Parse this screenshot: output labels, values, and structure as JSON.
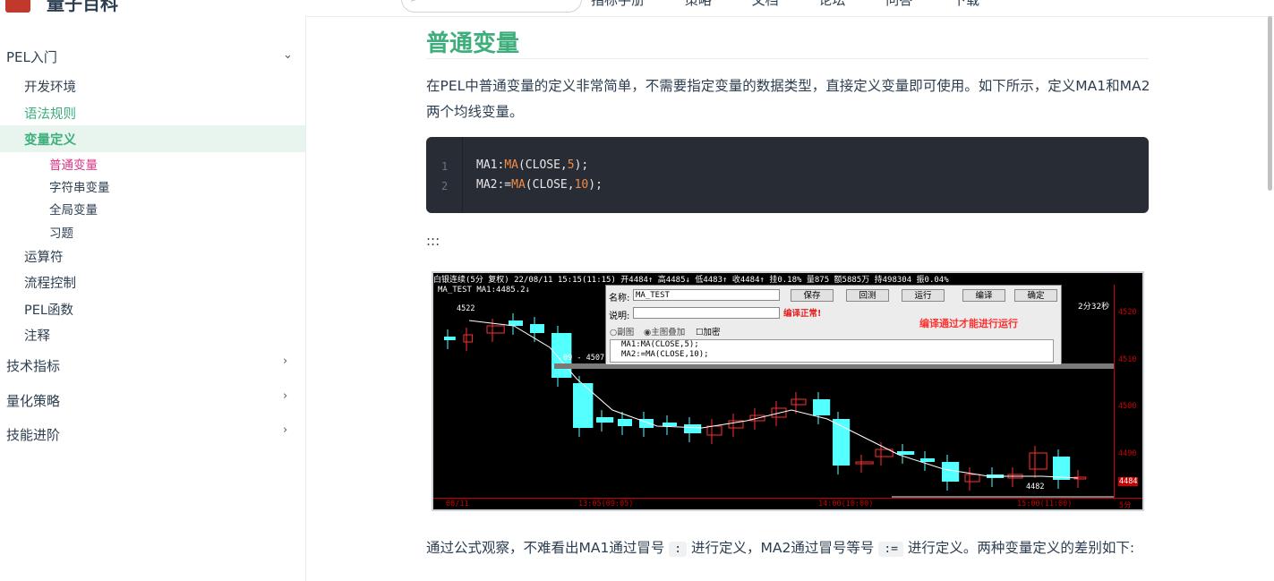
{
  "header": {
    "site_title": "量子百科",
    "nav": [
      "指标手册",
      "策略",
      "文档",
      "论坛",
      "问答",
      "下载"
    ]
  },
  "sidebar": {
    "groups": [
      {
        "title": "PEL入门",
        "expanded": true
      },
      {
        "title": "技术指标",
        "expanded": false
      },
      {
        "title": "量化策略",
        "expanded": false
      },
      {
        "title": "技能进阶",
        "expanded": false
      }
    ],
    "items": [
      "开发环境",
      "语法规则",
      "变量定义",
      "运算符",
      "流程控制",
      "PEL函数",
      "注释"
    ],
    "subitems": [
      "普通变量",
      "字符串变量",
      "全局变量",
      "习题"
    ]
  },
  "article": {
    "title": "普通变量",
    "intro": "在PEL中普通变量的定义非常简单，不需要指定变量的数据类型，直接定义变量即可使用。如下所示，定义MA1和MA2两个均线变量。",
    "code": {
      "line_numbers": [
        "1",
        "2"
      ],
      "line1": {
        "a": "MA1:",
        "fn": "MA",
        "b": "(CLOSE,",
        "num": "5",
        "c": ");"
      },
      "line2": {
        "a": "MA2:=",
        "fn": "MA",
        "b": "(CLOSE,",
        "num": "10",
        "c": ");"
      }
    },
    "colons": ":::",
    "outro_a": "通过公式观察，不难看出MA1通过冒号",
    "outro_code1": ":",
    "outro_b": "进行定义，MA2通过冒号等号",
    "outro_code2": ":=",
    "outro_c": "进行定义。两种变量定义的差别如下:"
  },
  "screenshot": {
    "title_line": "白银连续(5分 复权) 22/08/11 15:15(11:15)  开4484↑ 高4485↓ 低4483↑ 收4484↑ 挂0.18% 量875 额5885万 持498304 振0.04%",
    "legend": "MA_TEST MA1:4485.2↓",
    "dialog": {
      "name_label": "名称:",
      "name_value": "MA_TEST",
      "desc_label": "说明:",
      "status": "编译正常!",
      "hint": "编译通过才能进行运行",
      "buttons": [
        "保存",
        "回测",
        "运行",
        "编译",
        "确定"
      ],
      "check_sub": "副图",
      "check_main": "主图叠加",
      "check_encrypt": "加密",
      "code_line1": "MA1:MA(CLOSE,5);",
      "code_line2": "MA2:=MA(CLOSE,10);"
    },
    "countdown": "2分32秒",
    "price_labels": [
      "4520",
      "4510",
      "4500",
      "4490",
      "4484"
    ],
    "time_labels": [
      "08/11",
      "13:05(09:05)",
      "14:00(10:00)",
      "15:00(11:00)",
      "5分"
    ],
    "marker_high": "4522",
    "marker_low": "4482",
    "marker_mid": "09 - 4507",
    "colors": {
      "up": "#ff3030",
      "down": "#54ffff",
      "ma_line": "#ffffff",
      "accent": "#3eaf7c"
    }
  }
}
